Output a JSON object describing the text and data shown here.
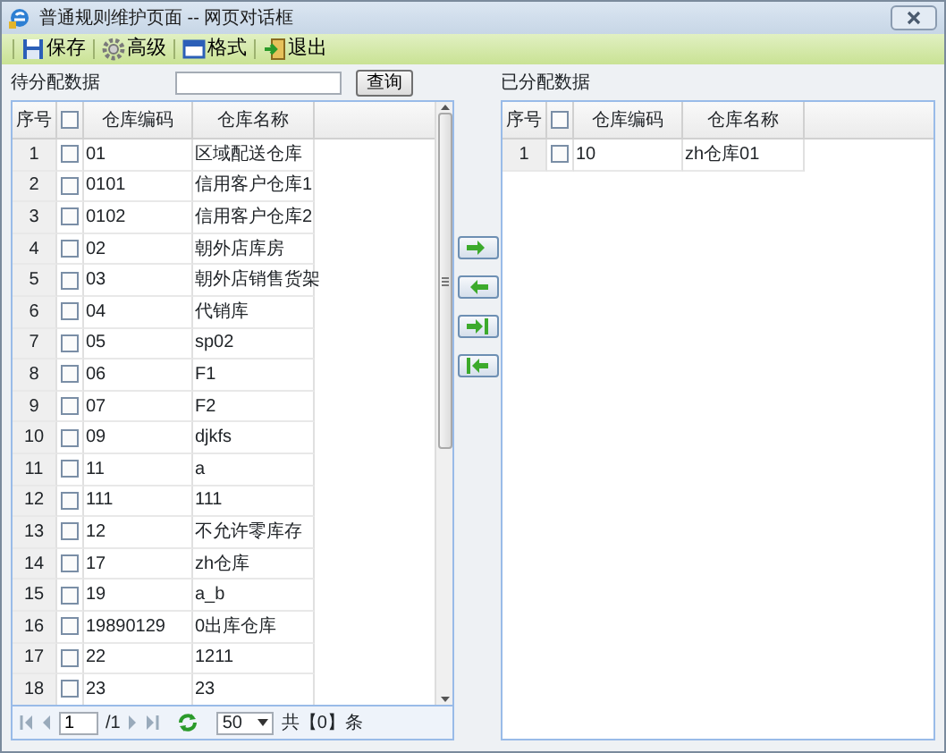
{
  "window": {
    "title": "普通规则维护页面 -- 网页对话框"
  },
  "toolbar": [
    {
      "kind": "save",
      "label": "保存"
    },
    {
      "kind": "gear",
      "label": "高级"
    },
    {
      "kind": "format",
      "label": "格式"
    },
    {
      "kind": "exit",
      "label": "退出"
    }
  ],
  "left_panel": {
    "title": "待分配数据",
    "search_button": "查询",
    "columns": [
      "序号",
      "仓库编码",
      "仓库名称"
    ],
    "header_checked": false,
    "rows": [
      {
        "index": "1",
        "code": "01",
        "name": "区域配送仓库",
        "checked": false
      },
      {
        "index": "2",
        "code": "0101",
        "name": "信用客户仓库1",
        "checked": false
      },
      {
        "index": "3",
        "code": "0102",
        "name": "信用客户仓库2",
        "checked": false
      },
      {
        "index": "4",
        "code": "02",
        "name": "朝外店库房",
        "checked": false
      },
      {
        "index": "5",
        "code": "03",
        "name": "朝外店销售货架",
        "checked": false
      },
      {
        "index": "6",
        "code": "04",
        "name": "代销库",
        "checked": false
      },
      {
        "index": "7",
        "code": "05",
        "name": "sp02",
        "checked": false
      },
      {
        "index": "8",
        "code": "06",
        "name": "F1",
        "checked": false
      },
      {
        "index": "9",
        "code": "07",
        "name": "F2",
        "checked": false
      },
      {
        "index": "10",
        "code": "09",
        "name": "djkfs",
        "checked": false
      },
      {
        "index": "11",
        "code": "11",
        "name": "a",
        "checked": false
      },
      {
        "index": "12",
        "code": "111",
        "name": "111",
        "checked": false
      },
      {
        "index": "13",
        "code": "12",
        "name": "不允许零库存",
        "checked": false
      },
      {
        "index": "14",
        "code": "17",
        "name": "zh仓库",
        "checked": false
      },
      {
        "index": "15",
        "code": "19",
        "name": "a_b",
        "checked": false
      },
      {
        "index": "16",
        "code": "19890129",
        "name": "0出库仓库",
        "checked": false
      },
      {
        "index": "17",
        "code": "22",
        "name": "1211",
        "checked": false
      },
      {
        "index": "18",
        "code": "23",
        "name": "23",
        "checked": false
      }
    ],
    "pager": {
      "page": "1",
      "pages": "/1",
      "page_size": "50",
      "total": "共【0】条"
    }
  },
  "transfer_buttons": [
    {
      "kind": "right"
    },
    {
      "kind": "left"
    },
    {
      "kind": "all-right"
    },
    {
      "kind": "all-left"
    }
  ],
  "right_panel": {
    "title": "已分配数据",
    "columns": [
      "序号",
      "仓库编码",
      "仓库名称"
    ],
    "header_checked": false,
    "rows": [
      {
        "index": "1",
        "code": "10",
        "name": "zh仓库01",
        "checked": false
      }
    ]
  }
}
